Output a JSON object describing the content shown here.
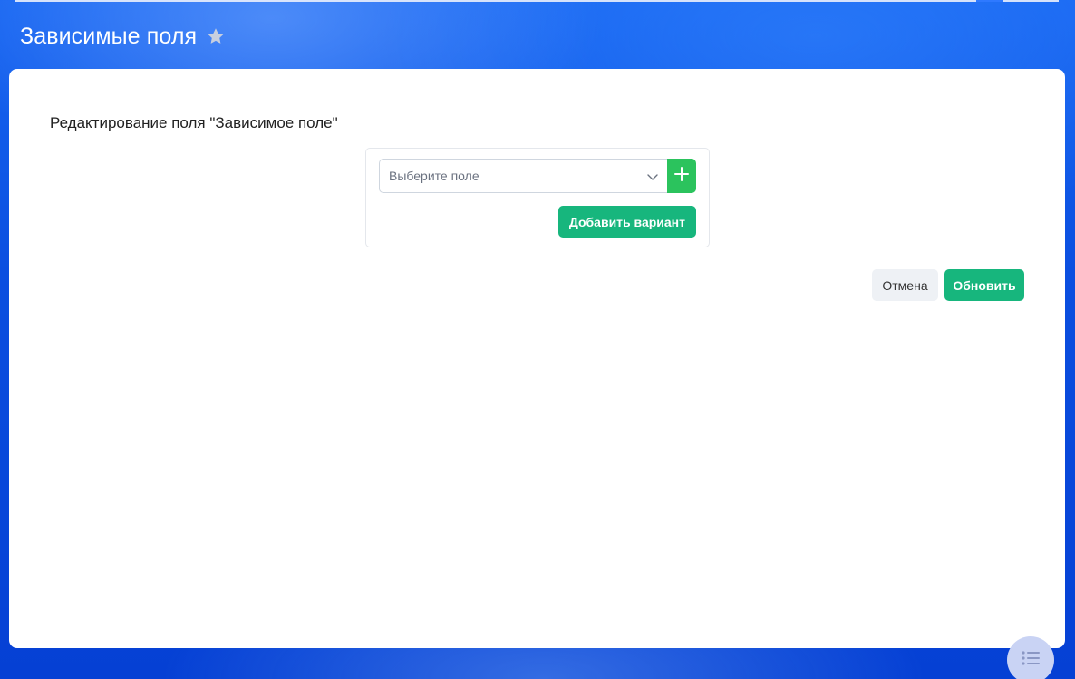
{
  "header": {
    "title": "Зависимые поля",
    "favorite_icon": "star-icon"
  },
  "form": {
    "title": "Редактирование поля \"Зависимое поле\"",
    "select": {
      "placeholder": "Выберите поле",
      "icon": "chevron-down-icon"
    },
    "plus_icon": "plus-icon",
    "add_variant_label": "Добавить вариант"
  },
  "actions": {
    "cancel_label": "Отмена",
    "update_label": "Обновить"
  },
  "fab": {
    "icon": "list-icon"
  },
  "colors": {
    "accent_green": "#17b67d",
    "plus_green": "#2bc35d",
    "background_blue": "#0a4ee0"
  }
}
